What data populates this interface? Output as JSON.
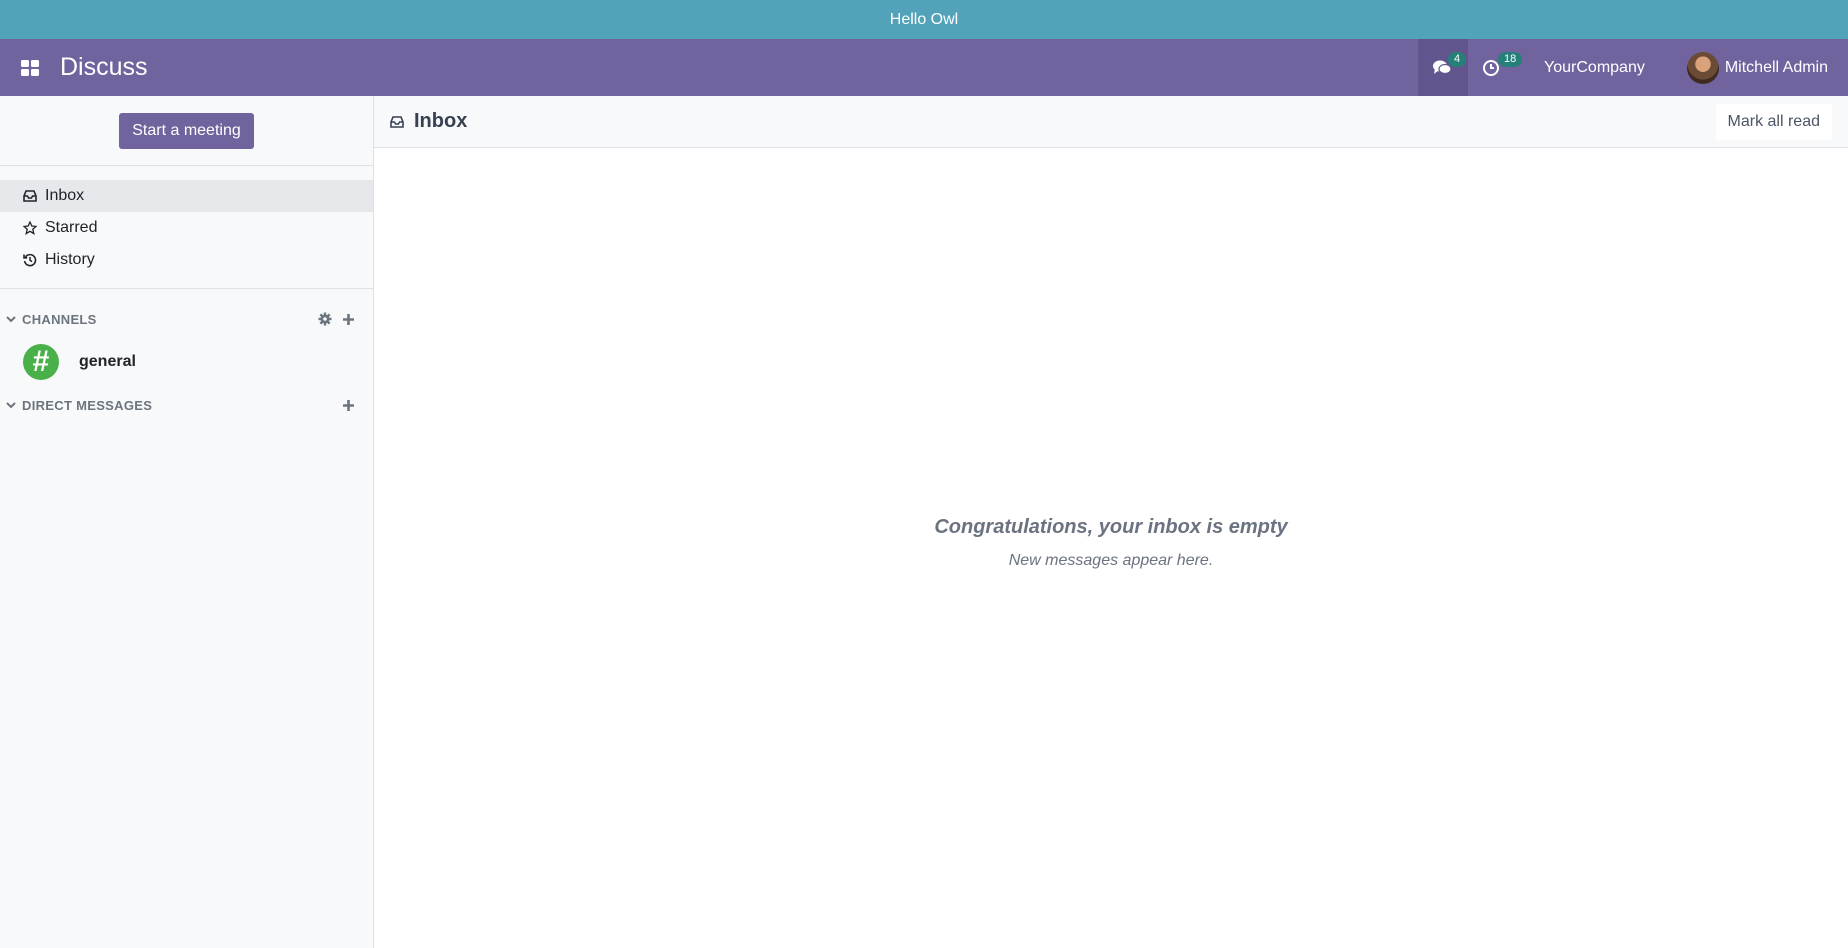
{
  "banner": {
    "text": "Hello Owl"
  },
  "navbar": {
    "app_title": "Discuss",
    "messages_badge": "4",
    "activities_badge": "18",
    "company": "YourCompany",
    "user_name": "Mitchell Admin"
  },
  "sidebar": {
    "start_meeting": "Start a meeting",
    "mailboxes": [
      {
        "label": "Inbox",
        "icon": "inbox-icon"
      },
      {
        "label": "Starred",
        "icon": "star-icon"
      },
      {
        "label": "History",
        "icon": "history-icon"
      }
    ],
    "channels_header": "CHANNELS",
    "channels": [
      {
        "name": "general"
      }
    ],
    "dm_header": "DIRECT MESSAGES"
  },
  "main": {
    "title": "Inbox",
    "mark_all_read": "Mark all read",
    "empty_title": "Congratulations, your inbox is empty",
    "empty_subtitle": "New messages appear here."
  },
  "colors": {
    "banner": "#52a3b9",
    "navbar": "#71639e",
    "badge": "#26807a",
    "channel_avatar": "#4ab04a"
  }
}
